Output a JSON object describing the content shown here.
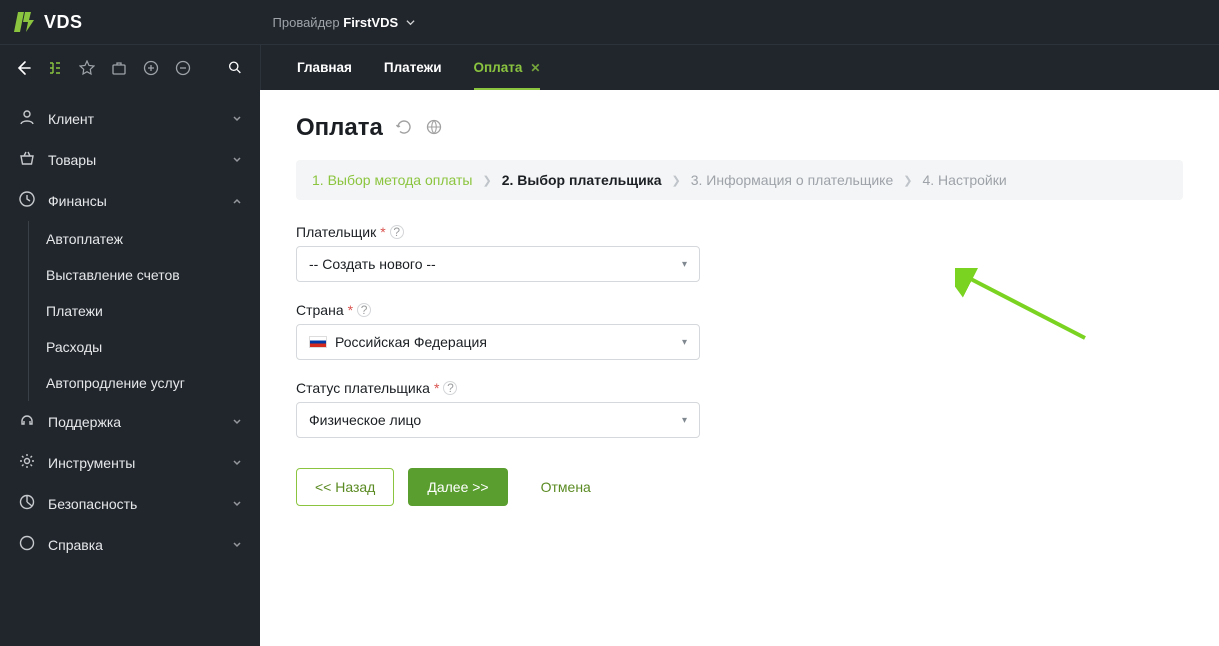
{
  "logo_text": "VDS",
  "provider_label": "Провайдер",
  "provider_name": "FirstVDS",
  "tabs": [
    {
      "label": "Главная",
      "active": false,
      "closable": false
    },
    {
      "label": "Платежи",
      "active": false,
      "closable": false
    },
    {
      "label": "Оплата",
      "active": true,
      "closable": true
    }
  ],
  "sidebar": [
    {
      "key": "client",
      "label": "Клиент",
      "expanded": false
    },
    {
      "key": "goods",
      "label": "Товары",
      "expanded": false
    },
    {
      "key": "finance",
      "label": "Финансы",
      "expanded": true,
      "children": [
        {
          "key": "autopay",
          "label": "Автоплатеж"
        },
        {
          "key": "invoice",
          "label": "Выставление счетов"
        },
        {
          "key": "payments",
          "label": "Платежи"
        },
        {
          "key": "expenses",
          "label": "Расходы"
        },
        {
          "key": "autorenew",
          "label": "Автопродление услуг"
        }
      ]
    },
    {
      "key": "support",
      "label": "Поддержка",
      "expanded": false
    },
    {
      "key": "tools",
      "label": "Инструменты",
      "expanded": false
    },
    {
      "key": "security",
      "label": "Безопасность",
      "expanded": false
    },
    {
      "key": "help",
      "label": "Справка",
      "expanded": false
    }
  ],
  "page_title": "Оплата",
  "steps": [
    {
      "num": "1",
      "label": "Выбор метода оплаты",
      "state": "done"
    },
    {
      "num": "2",
      "label": "Выбор плательщика",
      "state": "active"
    },
    {
      "num": "3",
      "label": "Информация о плательщике",
      "state": "future"
    },
    {
      "num": "4",
      "label": "Настройки",
      "state": "future"
    }
  ],
  "form": {
    "payer_label": "Плательщик",
    "payer_value": "-- Создать нового --",
    "country_label": "Страна",
    "country_value": "Российская Федерация",
    "status_label": "Статус плательщика",
    "status_value": "Физическое лицо"
  },
  "buttons": {
    "back": "<< Назад",
    "next": "Далее >>",
    "cancel": "Отмена"
  },
  "colors": {
    "accent": "#8bc53f",
    "dark": "#21262d"
  }
}
